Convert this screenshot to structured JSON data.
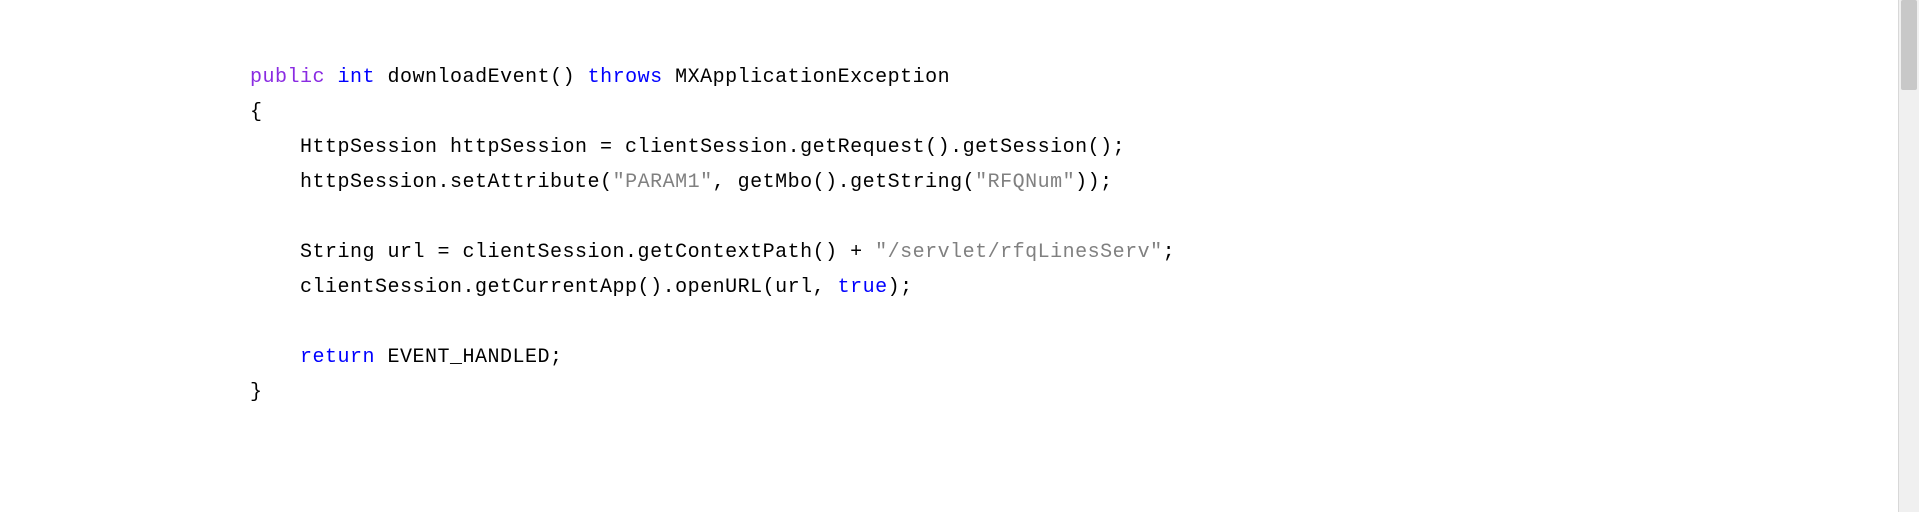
{
  "code": {
    "line1_kw1": "public",
    "line1_kw2": "int",
    "line1_method": " downloadEvent() ",
    "line1_kw3": "throws",
    "line1_rest": " MXApplicationException",
    "line2": "{",
    "line3_a": "    HttpSession httpSession = clientSession.getRequest().getSession();",
    "line4_a": "    httpSession.setAttribute(",
    "line4_str1": "\"PARAM1\"",
    "line4_b": ", getMbo().getString(",
    "line4_str2": "\"RFQNum\"",
    "line4_c": "));",
    "line5_ws": "    ",
    "line6_a": "    String url = clientSession.getContextPath() + ",
    "line6_str": "\"/servlet/rfqLinesServ\"",
    "line6_b": ";",
    "line7_a": "    clientSession.getCurrentApp().openURL(url, ",
    "line7_kw": "true",
    "line7_b": ");",
    "line8": "",
    "line9_kw": "    return",
    "line9_b": " EVENT_HANDLED;",
    "line10": "}"
  }
}
